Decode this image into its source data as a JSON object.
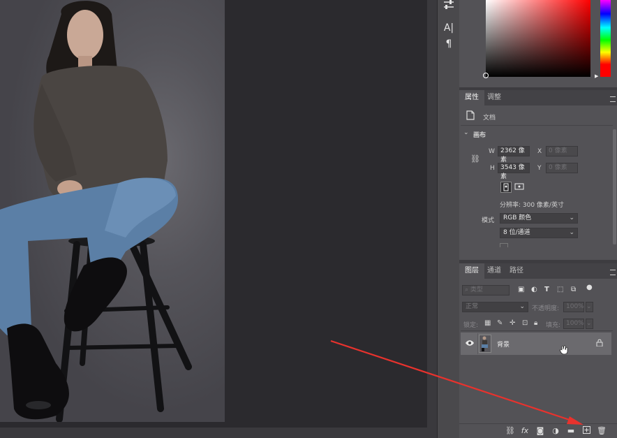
{
  "properties_panel": {
    "tabs": [
      "属性",
      "调整"
    ],
    "doc_label": "文档",
    "canvas_section": "画布",
    "w_label": "W",
    "w_value": "2362 像素",
    "h_label": "H",
    "h_value": "3543 像素",
    "x_label": "X",
    "x_placeholder": "0 像素",
    "y_label": "Y",
    "y_placeholder": "0 像素",
    "resolution": "分辨率: 300 像素/英寸",
    "mode_label": "模式",
    "mode_value": "RGB 颜色",
    "bit_depth": "8 位/通道"
  },
  "layers_panel": {
    "tabs": [
      "图层",
      "通道",
      "路径"
    ],
    "filter_placeholder": "类型",
    "blend_mode": "正常",
    "opacity_label": "不透明度:",
    "opacity_value": "100%",
    "lock_label": "锁定:",
    "fill_label": "填充:",
    "fill_value": "100%",
    "layers": [
      {
        "name": "背景",
        "visible": true,
        "locked": true
      }
    ]
  },
  "tool_strip": {
    "glyph_text_tool": "A|",
    "glyph_paragraph": "¶"
  },
  "bottom_icons": [
    "link-icon",
    "fx-icon",
    "mask-icon",
    "adjustment-icon",
    "folder-icon",
    "new-layer-icon",
    "trash-icon"
  ],
  "fx_text": "fx",
  "colors": {
    "annotation_arrow": "#e8322d",
    "panel_bg": "#535256",
    "selected_layer": "#6b6a6e"
  }
}
